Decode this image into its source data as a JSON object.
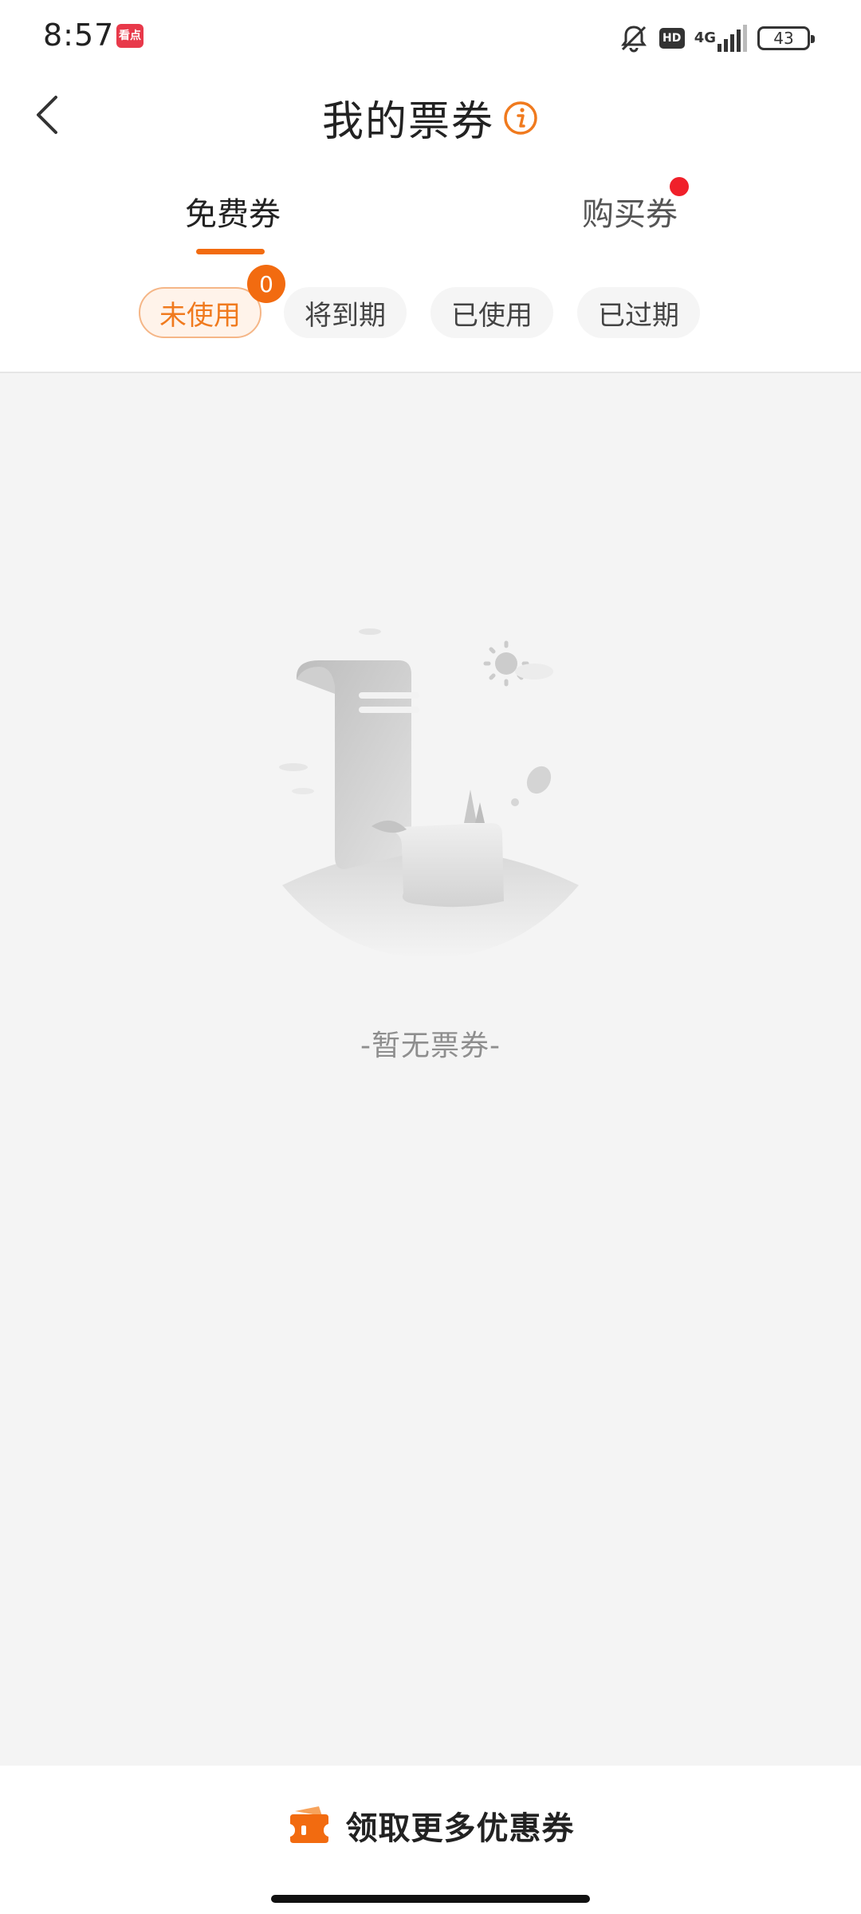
{
  "status_bar": {
    "time": "8:57",
    "app_icon_text": "看点",
    "hd": "HD",
    "network": "4G",
    "battery": "43"
  },
  "header": {
    "title": "我的票券"
  },
  "main_tabs": [
    {
      "label": "免费券",
      "active": true
    },
    {
      "label": "购买券",
      "active": false,
      "has_dot": true
    }
  ],
  "sub_tabs": [
    {
      "label": "未使用",
      "active": true,
      "badge": "0"
    },
    {
      "label": "将到期",
      "active": false
    },
    {
      "label": "已使用",
      "active": false
    },
    {
      "label": "已过期",
      "active": false
    }
  ],
  "empty_state": {
    "text": "-暂无票券-"
  },
  "bottom_bar": {
    "cta_label": "领取更多优惠券"
  },
  "colors": {
    "accent": "#f26b10",
    "dot": "#f0202a",
    "background": "#f4f4f4"
  }
}
